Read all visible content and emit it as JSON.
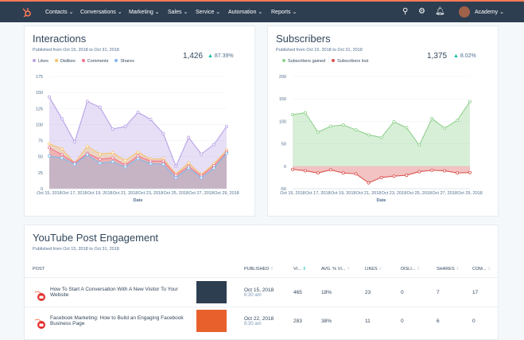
{
  "nav": {
    "items": [
      "Contacts",
      "Conversations",
      "Marketing",
      "Sales",
      "Service",
      "Automation",
      "Reports"
    ],
    "account": "Academy",
    "icons": [
      "hubspot-logo-icon",
      "search-icon",
      "gear-icon",
      "bell-icon"
    ]
  },
  "colors": {
    "nav_bg": "#2d3e50",
    "accent": "#ff7a59",
    "up": "#00bda5"
  },
  "interactions": {
    "title": "Interactions",
    "subtitle": "Published from Oct 15, 2018 to Oct 31, 2018",
    "total": "1,426",
    "change": "87.39%",
    "xlabel": "Date"
  },
  "subscribers": {
    "title": "Subscribers",
    "subtitle": "Published from Oct 15, 2018 to Oct 31, 2018",
    "total": "1,375",
    "change": "8.02%",
    "xlabel": "Date"
  },
  "chart_data": [
    {
      "type": "area",
      "title": "Interactions",
      "xlabel": "Date",
      "ylim": [
        0,
        175
      ],
      "yticks": [
        0,
        25,
        50,
        75,
        100,
        125,
        150,
        175
      ],
      "grid": true,
      "legend": "top-left",
      "x": [
        "Oct 15, 2018",
        "Oct 16, 2018",
        "Oct 17, 2018",
        "Oct 18, 2018",
        "Oct 19, 2018",
        "Oct 20, 2018",
        "Oct 21, 2018",
        "Oct 22, 2018",
        "Oct 23, 2018",
        "Oct 24, 2018",
        "Oct 25, 2018",
        "Oct 26, 2018",
        "Oct 27, 2018",
        "Oct 28, 2018",
        "Oct 29, 2018"
      ],
      "xtick_labels": [
        "Oct 15, 2018",
        "Oct 17, 2018",
        "Oct 19, 2018",
        "Oct 21, 2018",
        "Oct 23, 2018",
        "Oct 25, 2018",
        "Oct 27, 2018",
        "Oct 29, 2018"
      ],
      "series": [
        {
          "name": "Likes",
          "color": "#b9a2e6",
          "values": [
            143,
            109,
            73,
            136,
            127,
            93,
            97,
            119,
            108,
            86,
            35,
            80,
            54,
            69,
            97
          ]
        },
        {
          "name": "Dislikes",
          "color": "#f5c26b",
          "values": [
            70,
            62,
            40,
            66,
            54,
            56,
            44,
            57,
            46,
            47,
            23,
            40,
            22,
            39,
            60
          ]
        },
        {
          "name": "Comments",
          "color": "#f2738c",
          "values": [
            64,
            53,
            40,
            55,
            46,
            48,
            37,
            51,
            43,
            43,
            21,
            35,
            20,
            36,
            57
          ]
        },
        {
          "name": "Shares",
          "color": "#7fb8ec",
          "values": [
            51,
            48,
            38,
            53,
            40,
            42,
            34,
            47,
            39,
            38,
            17,
            32,
            17,
            32,
            55
          ]
        }
      ]
    },
    {
      "type": "area",
      "title": "Subscribers",
      "xlabel": "Date",
      "ylim": [
        -50,
        200
      ],
      "yticks": [
        -50,
        0,
        50,
        100,
        150,
        200
      ],
      "grid": true,
      "legend": "top-left",
      "x": [
        "Oct 15, 2018",
        "Oct 16, 2018",
        "Oct 17, 2018",
        "Oct 18, 2018",
        "Oct 19, 2018",
        "Oct 20, 2018",
        "Oct 21, 2018",
        "Oct 22, 2018",
        "Oct 23, 2018",
        "Oct 24, 2018",
        "Oct 25, 2018",
        "Oct 26, 2018",
        "Oct 27, 2018",
        "Oct 28, 2018",
        "Oct 29, 2018"
      ],
      "xtick_labels": [
        "Oct 15, 2018",
        "Oct 17, 2018",
        "Oct 19, 2018",
        "Oct 21, 2018",
        "Oct 23, 2018",
        "Oct 25, 2018",
        "Oct 27, 2018",
        "Oct 29, 2018"
      ],
      "series": [
        {
          "name": "Subscribers gained",
          "color": "#8fd18d",
          "values": [
            115,
            119,
            76,
            89,
            92,
            81,
            70,
            64,
            99,
            86,
            47,
            106,
            85,
            102,
            144
          ]
        },
        {
          "name": "Subscribers lost",
          "color": "#d9534f",
          "values": [
            -7,
            -10,
            -15,
            -8,
            -15,
            -17,
            -37,
            -25,
            -22,
            -20,
            -12,
            -9,
            -10,
            -15,
            -14
          ]
        }
      ]
    }
  ],
  "youtube": {
    "title": "YouTube Post Engagement",
    "subtitle": "Published from Oct 15, 2018 to Oct 31, 2018",
    "columns": [
      "POST",
      "PUBLISHED",
      "VI...",
      "AVG. % VI...",
      "LIKES",
      "DISLI...",
      "SHARES",
      "COM..."
    ],
    "rows": [
      {
        "post": "How To Start A Conversation With A New Visitor To Your Website",
        "date": "Oct 15, 2018",
        "time": "8:30 am",
        "views": "465",
        "avg": "18%",
        "likes": "23",
        "dislikes": "0",
        "shares": "7",
        "comments": "17"
      },
      {
        "post": "Facebook Marketing: How to Build an Engaging Facebook Business Page",
        "date": "Oct 22, 2018",
        "time": "8:30 am",
        "views": "283",
        "avg": "38%",
        "likes": "11",
        "dislikes": "0",
        "shares": "6",
        "comments": "0"
      }
    ]
  }
}
